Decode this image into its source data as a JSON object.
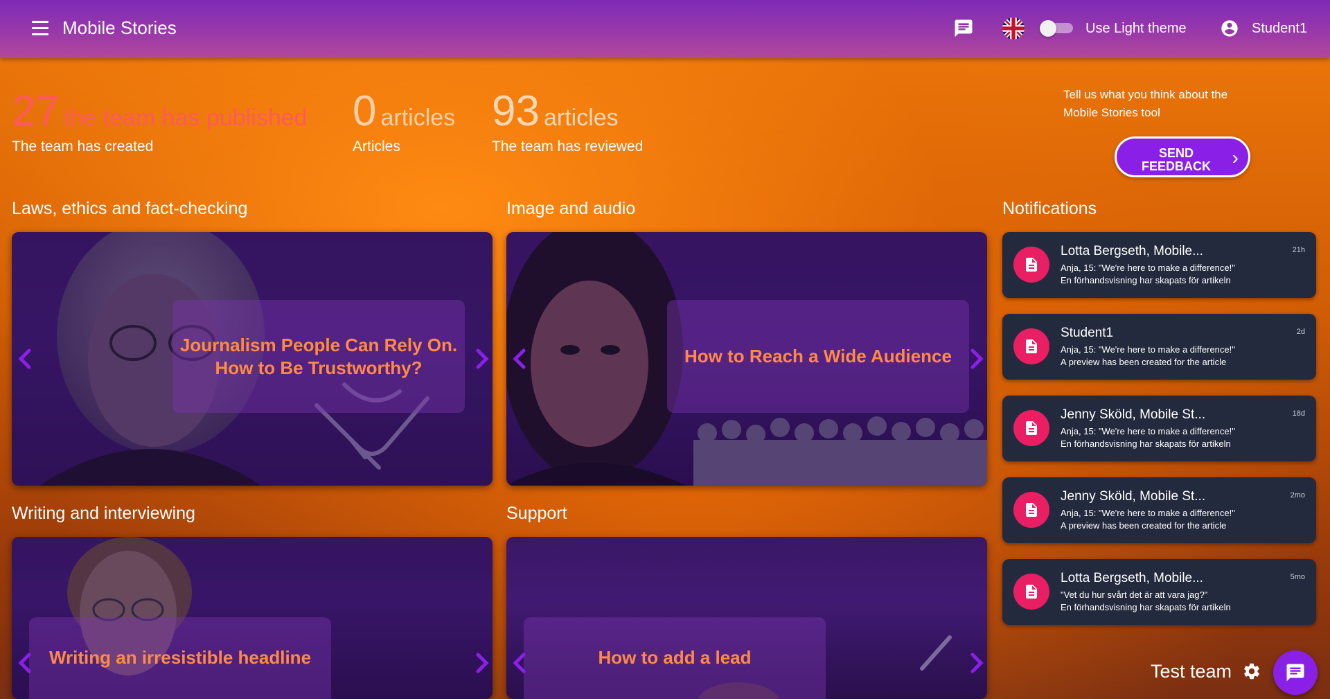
{
  "header": {
    "app_title": "Mobile Stories",
    "theme_label": "Use Light theme",
    "user_name": "Student1",
    "language_icon": "uk-flag-icon",
    "chat_icon": "chat-icon"
  },
  "stats": [
    {
      "number": "27",
      "word": "the team has published",
      "caption": "The team has created"
    },
    {
      "number": "0",
      "word": "articles",
      "caption": "Articles"
    },
    {
      "number": "93",
      "word": "articles",
      "caption": "The team has reviewed"
    }
  ],
  "feedback": {
    "text": "Tell us what you think about the Mobile Stories tool",
    "button_line1": "SEND",
    "button_line2": "FEEDBACK"
  },
  "sections": [
    {
      "title": "Laws, ethics and fact-checking",
      "card_text": "Journalism People Can Rely On. How to Be Trustworthy?"
    },
    {
      "title": "Image and audio",
      "card_text": "How to Reach a Wide Audience"
    },
    {
      "title": "Writing and interviewing",
      "card_text": "Writing an irresistible headline"
    },
    {
      "title": "Support",
      "card_text": "How to add a lead"
    }
  ],
  "notifications": {
    "title": "Notifications",
    "items": [
      {
        "title": "Lotta Bergseth, Mobile...",
        "line1": "Anja, 15: \"We're here to make a difference!\"",
        "line2": "En förhandsvisning har skapats för artikeln",
        "time": "21h"
      },
      {
        "title": "Student1",
        "line1": "Anja, 15: \"We're here to make a difference!\"",
        "line2": "A preview has been created for the article",
        "time": "2d"
      },
      {
        "title": "Jenny Sköld, Mobile St...",
        "line1": "Anja, 15: \"We're here to make a difference!\"",
        "line2": "En förhandsvisning har skapats för artikeln",
        "time": "18d"
      },
      {
        "title": "Jenny Sköld, Mobile St...",
        "line1": "Anja, 15: \"We're here to make a difference!\"",
        "line2": "A preview has been created for the article",
        "time": "2mo"
      },
      {
        "title": "Lotta Bergseth, Mobile...",
        "line1": "\"Vet du hur svårt det är att vara jag?\"",
        "line2": "En förhandsvisning har skapats för artikeln",
        "time": "5mo"
      }
    ]
  },
  "footer": {
    "team_name": "Test team"
  },
  "colors": {
    "accent": "#8a20e8",
    "notification_icon": "#e91e63",
    "card_text": "#ff8a45",
    "stat_published": "#ff5a5a"
  }
}
